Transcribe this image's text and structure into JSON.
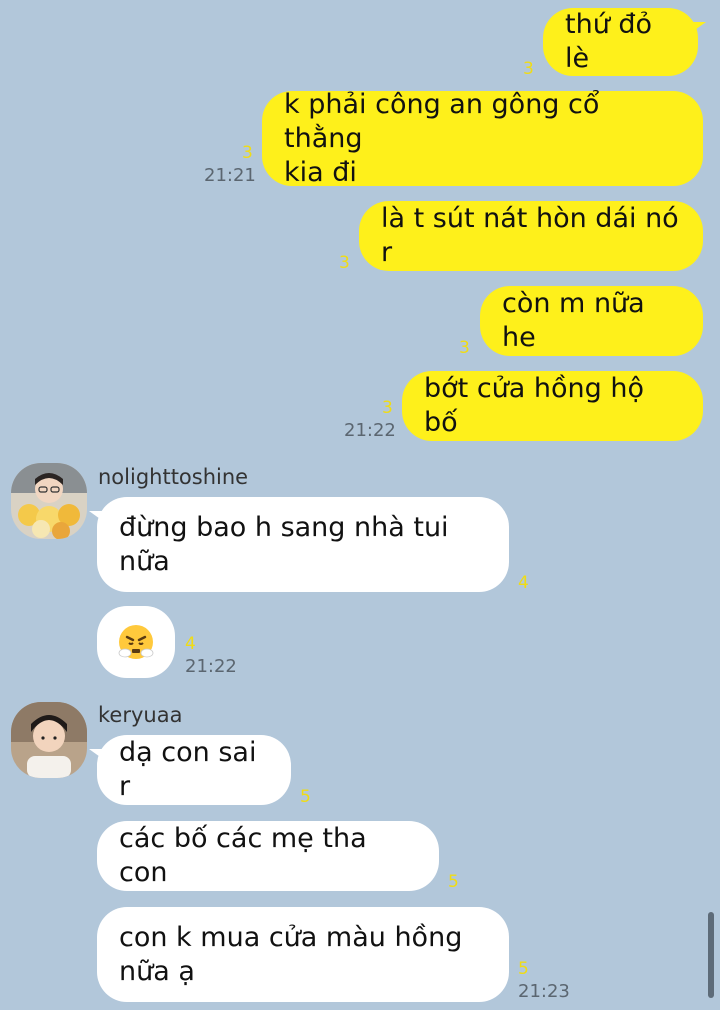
{
  "messages_out": [
    {
      "text": "thứ đỏ lè",
      "unread": "3",
      "time": ""
    },
    {
      "text": "k phải công an gông cổ thằng\nkia đi",
      "unread": "3",
      "time": "21:21"
    },
    {
      "text": "là t sút nát hòn dái nó r",
      "unread": "3",
      "time": ""
    },
    {
      "text": "còn m nữa he",
      "unread": "3",
      "time": ""
    },
    {
      "text": "bớt cửa hồng hộ bố",
      "unread": "3",
      "time": "21:22"
    }
  ],
  "group1": {
    "sender": "nolighttoshine",
    "avatar": "avatar-photo-nolighttoshine",
    "messages": [
      {
        "text": "đừng bao h sang nhà tui\nnữa",
        "unread": "4",
        "time": ""
      },
      {
        "emoji": "angry-steam-emoji",
        "unread": "4",
        "time": "21:22"
      }
    ]
  },
  "group2": {
    "sender": "keryuaa",
    "avatar": "avatar-photo-keryuaa",
    "messages": [
      {
        "text": "dạ con sai r",
        "unread": "5",
        "time": ""
      },
      {
        "text": "các bố các mẹ tha con",
        "unread": "5",
        "time": ""
      },
      {
        "text": "con k mua cửa màu hồng\nnữa ạ",
        "unread": "5",
        "time": "21:23"
      }
    ]
  },
  "colors": {
    "background": "#b2c7da",
    "outgoing_bubble": "#fef01b",
    "incoming_bubble": "#ffffff",
    "unread_count": "#f0dc14"
  }
}
